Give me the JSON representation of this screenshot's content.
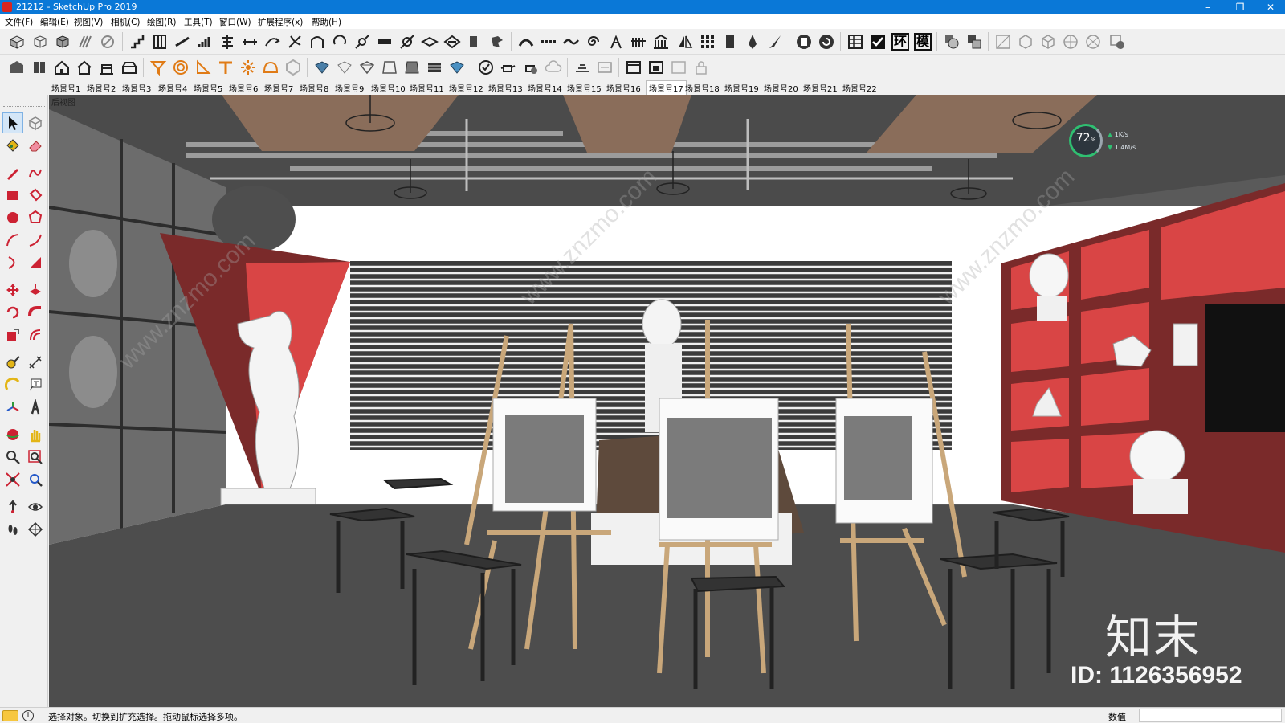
{
  "window": {
    "title": "21212 - SketchUp Pro 2019",
    "controls": [
      "–",
      "❐",
      "✕"
    ]
  },
  "menu": [
    "文件(F)",
    "编辑(E)",
    "视图(V)",
    "相机(C)",
    "绘图(R)",
    "工具(T)",
    "窗口(W)",
    "扩展程序(x)",
    "帮助(H)"
  ],
  "toolbar_text_icons": [
    "环",
    "模"
  ],
  "scene_tabs": [
    "场景号1",
    "场景号2",
    "场景号3",
    "场景号4",
    "场景号5",
    "场景号6",
    "场景号7",
    "场景号8",
    "场景号9",
    "场景号10",
    "场景号11",
    "场景号12",
    "场景号13",
    "场景号14",
    "场景号15",
    "场景号16",
    "场景号17",
    "场景号18",
    "场景号19",
    "场景号20",
    "场景号21",
    "场景号22"
  ],
  "active_scene_index": 16,
  "viewport": {
    "view_label": "后视图",
    "perf_widget": {
      "percent": "72",
      "percent_suffix": "%",
      "up_rate": "1K/s",
      "down_rate": "1.4M/s"
    },
    "watermark_brand": "知末",
    "watermark_id": "ID: 1126356952",
    "watermark_diag": "www.znzmo.com"
  },
  "colors": {
    "title_bar": "#0a78d7",
    "accent_red": "#d94545",
    "dark_red": "#7a2a2a",
    "floor": "#4d4d4d",
    "wood": "#c9a77a"
  },
  "status": {
    "message": "选择对象。切换到扩充选择。拖动鼠标选择多项。",
    "measurements_label": "数值",
    "measurements_value": ""
  }
}
